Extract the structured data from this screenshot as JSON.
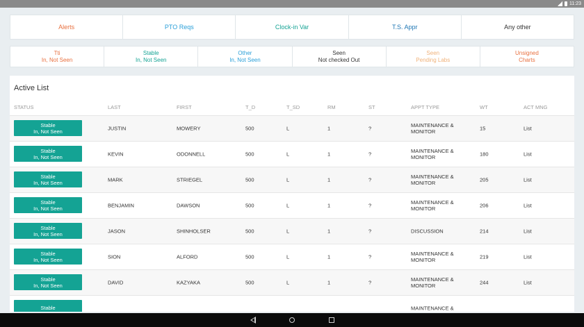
{
  "statusbar": {
    "time": "11:23"
  },
  "top_tabs": [
    {
      "label": "Alerts",
      "color": "#e8703f"
    },
    {
      "label": "PTO Reqs",
      "color": "#2a9fd8"
    },
    {
      "label": "Clock-in Var",
      "color": "#14a394"
    },
    {
      "label": "T.S. Appr",
      "color": "#2178b5"
    },
    {
      "label": "Any other",
      "color": "#333333"
    }
  ],
  "filters": [
    {
      "line1": "Tti",
      "line2": "In, Not Seen",
      "color": "#e8703f"
    },
    {
      "line1": "Stable",
      "line2": "In, Not Seen",
      "color": "#14a394"
    },
    {
      "line1": "Other",
      "line2": "In, Not Seen",
      "color": "#2a9fd8"
    },
    {
      "line1": "Seen",
      "line2": "Not checked Out",
      "color": "#333333"
    },
    {
      "line1": "Seen",
      "line2": "Pending Labs",
      "color": "#f0b27a"
    },
    {
      "line1": "Unsigned",
      "line2": "Charts",
      "color": "#e8703f"
    }
  ],
  "active_list": {
    "title": "Active List",
    "columns": {
      "status": "STATUS",
      "last": "LAST",
      "first": "FIRST",
      "td": "T_D",
      "tsd": "T_SD",
      "rm": "RM",
      "st": "ST",
      "appt": "APPT TYPE",
      "wt": "WT",
      "act": "ACT MNG"
    },
    "rows": [
      {
        "status1": "Stable",
        "status2": "In, Not Seen",
        "last": "JUSTIN",
        "first": "MOWERY",
        "td": "500",
        "tsd": "L",
        "rm": "1",
        "st": "?",
        "appt": "MAINTENANCE & MONITOR",
        "wt": "15",
        "act": "List"
      },
      {
        "status1": "Stable",
        "status2": "In, Not Seen",
        "last": "KEVIN",
        "first": "ODONNELL",
        "td": "500",
        "tsd": "L",
        "rm": "1",
        "st": "?",
        "appt": "MAINTENANCE & MONITOR",
        "wt": "180",
        "act": "List"
      },
      {
        "status1": "Stable",
        "status2": "In, Not Seen",
        "last": "MARK",
        "first": "STRIEGEL",
        "td": "500",
        "tsd": "L",
        "rm": "1",
        "st": "?",
        "appt": "MAINTENANCE & MONITOR",
        "wt": "205",
        "act": "List"
      },
      {
        "status1": "Stable",
        "status2": "In, Not Seen",
        "last": "BENJAMIN",
        "first": "DAWSON",
        "td": "500",
        "tsd": "L",
        "rm": "1",
        "st": "?",
        "appt": "MAINTENANCE & MONITOR",
        "wt": "206",
        "act": "List"
      },
      {
        "status1": "Stable",
        "status2": "In, Not Seen",
        "last": "JASON",
        "first": "SHINHOLSER",
        "td": "500",
        "tsd": "L",
        "rm": "1",
        "st": "?",
        "appt": "DISCUSSION",
        "wt": "214",
        "act": "List"
      },
      {
        "status1": "Stable",
        "status2": "In, Not Seen",
        "last": "SION",
        "first": "ALFORD",
        "td": "500",
        "tsd": "L",
        "rm": "1",
        "st": "?",
        "appt": "MAINTENANCE & MONITOR",
        "wt": "219",
        "act": "List"
      },
      {
        "status1": "Stable",
        "status2": "In, Not Seen",
        "last": "DAVID",
        "first": "KAZYAKA",
        "td": "500",
        "tsd": "L",
        "rm": "1",
        "st": "?",
        "appt": "MAINTENANCE & MONITOR",
        "wt": "244",
        "act": "List"
      },
      {
        "status1": "Stable",
        "status2": "",
        "last": "",
        "first": "",
        "td": "",
        "tsd": "",
        "rm": "",
        "st": "",
        "appt": "MAINTENANCE &",
        "wt": "",
        "act": ""
      }
    ],
    "status_button_color": "#14a394"
  },
  "navbar": {
    "back_icon": "back-triangle",
    "home_icon": "home-circle",
    "recent_icon": "recents-square"
  }
}
